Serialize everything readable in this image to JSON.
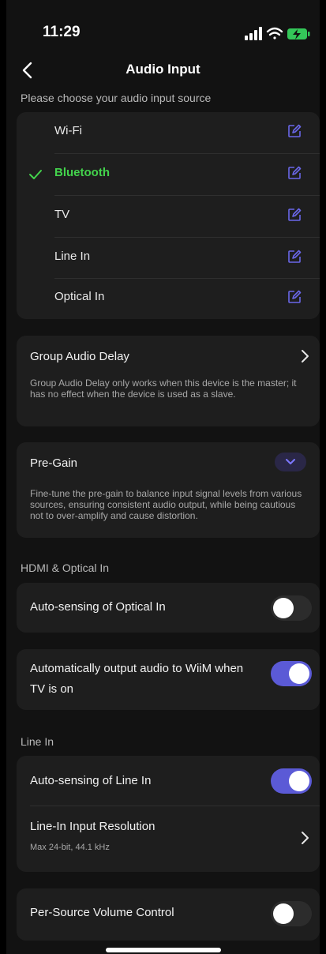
{
  "status_bar": {
    "time": "11:29",
    "icons": [
      "signal-icon",
      "wifi-icon",
      "battery-charging-icon"
    ]
  },
  "header": {
    "title": "Audio Input",
    "back_icon": "chevron-left-icon"
  },
  "source_section": {
    "label": "Please choose your audio input source",
    "sources": [
      {
        "label": "Wi-Fi",
        "selected": false
      },
      {
        "label": "Bluetooth",
        "selected": true
      },
      {
        "label": "TV",
        "selected": false
      },
      {
        "label": "Line In",
        "selected": false
      },
      {
        "label": "Optical In",
        "selected": false
      }
    ]
  },
  "group_audio_delay": {
    "title": "Group Audio Delay",
    "description": "Group Audio Delay only works when this device is the master; it has no effect when the device is used as a slave."
  },
  "pre_gain": {
    "title": "Pre-Gain",
    "description": "Fine-tune the pre-gain to balance input signal levels from various sources, ensuring consistent audio output, while being cautious not to over-amplify and cause distortion."
  },
  "hdmi_optical": {
    "label": "HDMI & Optical In",
    "auto_sensing_optical": {
      "title": "Auto-sensing of Optical In",
      "on": false
    },
    "auto_output_tv": {
      "title": "Automatically output audio to WiiM when TV is on",
      "on": true
    }
  },
  "line_in": {
    "label": "Line In",
    "auto_sensing_line_in": {
      "title": "Auto-sensing of Line In",
      "on": true
    },
    "resolution": {
      "title": "Line-In Input Resolution",
      "subtitle": "Max 24-bit, 44.1 kHz"
    }
  },
  "per_source_volume": {
    "title": "Per-Source Volume Control",
    "on": false
  },
  "colors": {
    "accent": "#5b5ad6",
    "selected": "#43d34c",
    "edit_icon": "#6a67e8",
    "card": "#1e1e1e",
    "background": "#121212"
  }
}
